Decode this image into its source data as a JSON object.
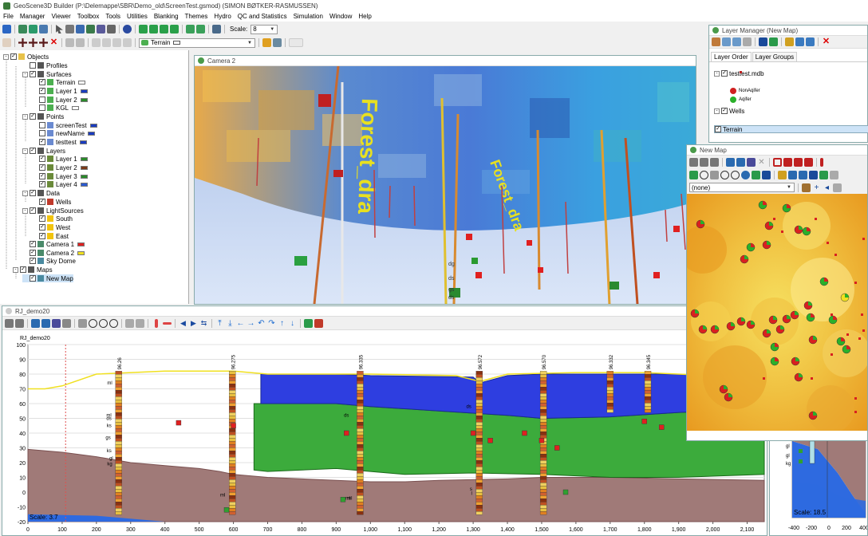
{
  "app": {
    "title": "GeoScene3D Builder (P:\\Delemappe\\SBR\\Demo_old\\ScreenTest.gsmod) (SIMON BØTKER-RASMUSSEN)"
  },
  "menu": [
    "File",
    "Manager",
    "Viewer",
    "Toolbox",
    "Tools",
    "Utilities",
    "Blanking",
    "Themes",
    "Hydro",
    "QC and Statistics",
    "Simulation",
    "Window",
    "Help"
  ],
  "toolbar": {
    "scale_label": "Scale:",
    "scale_value": "8",
    "layer_combo": "Terrain"
  },
  "tree": [
    {
      "label": "Objects",
      "x": 4,
      "y": 66,
      "chk": true,
      "exp": "-",
      "icon": "objects-icon",
      "ic": "#e8c24a"
    },
    {
      "label": "Profiles",
      "x": 28,
      "y": 77,
      "chk": false,
      "icon": "profiles-icon",
      "ic": "#555"
    },
    {
      "label": "Surfaces",
      "x": 28,
      "y": 88,
      "chk": true,
      "exp": "-",
      "icon": "surfaces-icon",
      "ic": "#555"
    },
    {
      "label": "Terrain",
      "x": 40,
      "y": 98,
      "chk": true,
      "icon": "surface-icon",
      "ic": "#4caf50",
      "sw": "#f4f4f4"
    },
    {
      "label": "Layer 1",
      "x": 40,
      "y": 109,
      "chk": true,
      "icon": "surface-icon",
      "ic": "#4caf50",
      "sw": "#1a3cc0"
    },
    {
      "label": "Layer 2",
      "x": 40,
      "y": 120,
      "chk": false,
      "icon": "surface-icon",
      "ic": "#4caf50",
      "sw": "#2a8a2a"
    },
    {
      "label": "KGL",
      "x": 40,
      "y": 130,
      "chk": false,
      "icon": "surface-icon",
      "ic": "#4caf50",
      "sw": "#ffffff"
    },
    {
      "label": "Points",
      "x": 28,
      "y": 141,
      "chk": true,
      "exp": "-",
      "icon": "points-icon",
      "ic": "#555"
    },
    {
      "label": "screenTest",
      "x": 40,
      "y": 152,
      "chk": false,
      "icon": "point-icon",
      "ic": "#6a8ad0",
      "sw": "#1a3cc0"
    },
    {
      "label": "newName",
      "x": 40,
      "y": 162,
      "chk": false,
      "icon": "point-icon",
      "ic": "#6a8ad0",
      "sw": "#1a3cc0"
    },
    {
      "label": "testtest",
      "x": 40,
      "y": 173,
      "chk": true,
      "icon": "point-icon",
      "ic": "#6a8ad0",
      "sw": "#1a3cc0"
    },
    {
      "label": "Layers",
      "x": 28,
      "y": 184,
      "chk": true,
      "exp": "-",
      "icon": "layers-icon",
      "ic": "#555"
    },
    {
      "label": "Layer 1",
      "x": 40,
      "y": 194,
      "chk": true,
      "icon": "layer-icon",
      "ic": "#6a8a3a",
      "sw": "#2a8a2a"
    },
    {
      "label": "Layer 2",
      "x": 40,
      "y": 205,
      "chk": true,
      "icon": "layer-icon",
      "ic": "#6a8a3a",
      "sw": "#7a3a1a"
    },
    {
      "label": "Layer 3",
      "x": 40,
      "y": 216,
      "chk": true,
      "icon": "layer-icon",
      "ic": "#6a8a3a",
      "sw": "#2a8a2a"
    },
    {
      "label": "Layer 4",
      "x": 40,
      "y": 226,
      "chk": true,
      "icon": "layer-icon",
      "ic": "#6a8a3a",
      "sw": "#2a5ad0"
    },
    {
      "label": "Data",
      "x": 28,
      "y": 237,
      "chk": true,
      "exp": "-",
      "icon": "data-icon",
      "ic": "#555"
    },
    {
      "label": "Wells",
      "x": 40,
      "y": 248,
      "chk": true,
      "icon": "wells-icon",
      "ic": "#c0392b"
    },
    {
      "label": "LightSources",
      "x": 28,
      "y": 259,
      "chk": true,
      "exp": "-",
      "icon": "light-icon",
      "ic": "#555"
    },
    {
      "label": "South",
      "x": 40,
      "y": 269,
      "chk": true,
      "icon": "sun-icon",
      "ic": "#f1c40f"
    },
    {
      "label": "West",
      "x": 40,
      "y": 280,
      "chk": true,
      "icon": "sun-icon",
      "ic": "#f1c40f"
    },
    {
      "label": "East",
      "x": 40,
      "y": 291,
      "chk": true,
      "icon": "sun-icon",
      "ic": "#f1c40f"
    },
    {
      "label": "Camera 1",
      "x": 28,
      "y": 301,
      "chk": true,
      "icon": "camera-icon",
      "ic": "#4a8a6a",
      "sw": "#e02020"
    },
    {
      "label": "Camera 2",
      "x": 28,
      "y": 312,
      "chk": true,
      "icon": "camera-icon",
      "ic": "#4a8a6a",
      "sw": "#f0e020"
    },
    {
      "label": "Sky Dome",
      "x": 28,
      "y": 322,
      "chk": true,
      "icon": "skydome-icon",
      "ic": "#4a8aa0"
    },
    {
      "label": "Maps",
      "x": 16,
      "y": 333,
      "chk": true,
      "exp": "-",
      "icon": "maps-icon",
      "ic": "#555"
    },
    {
      "label": "New Map",
      "x": 28,
      "y": 344,
      "chk": true,
      "icon": "map-icon",
      "ic": "#4a8aa0",
      "sel": true
    }
  ],
  "camera": {
    "title": "Camera 2",
    "text1": "Forest_dra",
    "text2": "Forest_dra",
    "text3": "dg",
    "text4": "ds",
    "text5": "gs",
    "text6": "ds"
  },
  "layer_manager": {
    "title": "Layer Manager (New Map)",
    "tabs": [
      "Layer Order",
      "Layer Groups"
    ],
    "items": [
      {
        "label": "testtest.mdb",
        "x": 16,
        "y": 54
      },
      {
        "label": "NonAqifer",
        "x": 36,
        "y": 76
      },
      {
        "label": "Aqifer",
        "x": 36,
        "y": 87
      },
      {
        "label": "Wells",
        "x": 16,
        "y": 101
      },
      {
        "label": "Terrain",
        "x": 16,
        "y": 124
      }
    ]
  },
  "new_map": {
    "title": "New Map",
    "combo": "(none)"
  },
  "rj": {
    "title": "RJ_demo20",
    "ylabel": "RJ_demo20",
    "scale": "Scale: 3.7",
    "yticks": [
      "100",
      "90",
      "80",
      "70",
      "60",
      "50",
      "40",
      "30",
      "20",
      "10",
      "0",
      "-10",
      "-20"
    ],
    "xticks": [
      "0",
      "100",
      "200",
      "300",
      "400",
      "500",
      "600",
      "700",
      "800",
      "900",
      "1,000",
      "1,100",
      "1,200",
      "1,300",
      "1,400",
      "1,500",
      "1,600",
      "1,700",
      "1,800",
      "1,900",
      "2,000",
      "2,100"
    ],
    "wells": [
      {
        "x": 265,
        "id": "96.26"
      },
      {
        "x": 597,
        "id": "96.275"
      },
      {
        "x": 970,
        "id": "96.335"
      },
      {
        "x": 1318,
        "id": "96.572"
      },
      {
        "x": 1505,
        "id": "96.570"
      },
      {
        "x": 1700,
        "id": "96.332"
      },
      {
        "x": 1810,
        "id": "96.345"
      }
    ],
    "labels": [
      "ml",
      "ml",
      "ds",
      "ks",
      "gs",
      "ks",
      "gl",
      "kg",
      "ds",
      "ds",
      "ml",
      "ml",
      "s",
      "l",
      "ml"
    ]
  },
  "side": {
    "scale": "Scale: 18.5",
    "xticks": [
      "-400",
      "-200",
      "0",
      "200",
      "400"
    ]
  }
}
